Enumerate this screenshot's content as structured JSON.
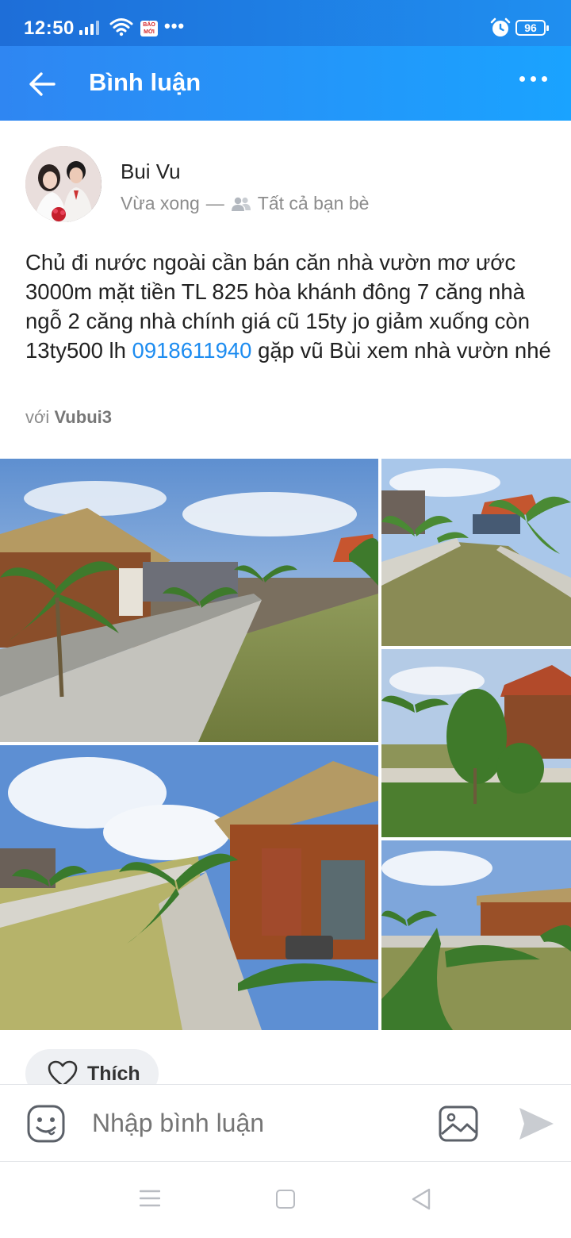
{
  "status_bar": {
    "time": "12:50",
    "notification_badge": "BÁO MỚI",
    "more_indicator": "•••",
    "battery": "96"
  },
  "header": {
    "title": "Bình luận",
    "back_icon": "arrow-left-icon",
    "more_icon": "more-horizontal-icon"
  },
  "post": {
    "author": "Bui Vu",
    "time": "Vừa xong",
    "separator": "—",
    "audience": "Tất cả bạn bè",
    "text_before": "Chủ đi nước ngoài cần bán căn nhà vườn mơ ước 3000m mặt tiền TL 825 hòa khánh đông 7 căng nhà ngỗ 2 căng nhà chính giá cũ 15ty jo giảm xuống còn 13ty500 lh ",
    "phone": "0918611940",
    "text_after": " gặp vũ Bùi xem nhà vườn nhé",
    "with_label": "với",
    "tagged_user": "Vubui3",
    "photos_count": 5
  },
  "actions": {
    "like_label": "Thích"
  },
  "comment_bar": {
    "placeholder": "Nhập bình luận"
  },
  "colors": {
    "header_start": "#2f86f2",
    "header_end": "#1aa3ff",
    "link": "#1d8cf0"
  }
}
